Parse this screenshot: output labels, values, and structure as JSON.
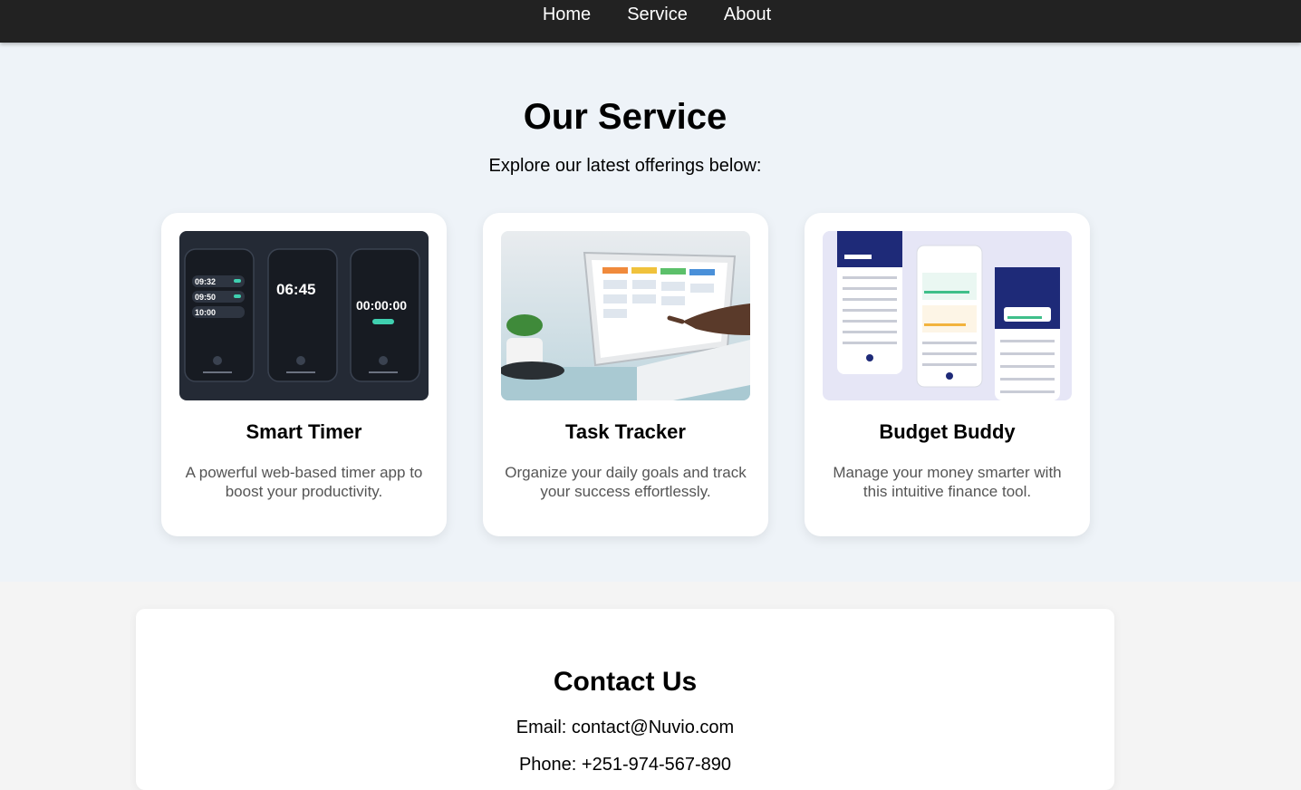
{
  "nav": {
    "items": [
      {
        "label": "Home"
      },
      {
        "label": "Service"
      },
      {
        "label": "About"
      }
    ]
  },
  "services": {
    "title": "Our Service",
    "subtitle": "Explore our latest offerings below:",
    "cards": [
      {
        "title": "Smart Timer",
        "description": "A powerful web-based timer app to boost your productivity.",
        "image_times": [
          "09:32",
          "09:50",
          "10:00",
          "06:45",
          "00:00:00"
        ]
      },
      {
        "title": "Task Tracker",
        "description": "Organize your daily goals and track your success effortlessly."
      },
      {
        "title": "Budget Buddy",
        "description": "Manage your money smarter with this intuitive finance tool."
      }
    ]
  },
  "contact": {
    "title": "Contact Us",
    "email": "Email: contact@Nuvio.com",
    "phone": "Phone: +251-974-567-890"
  }
}
